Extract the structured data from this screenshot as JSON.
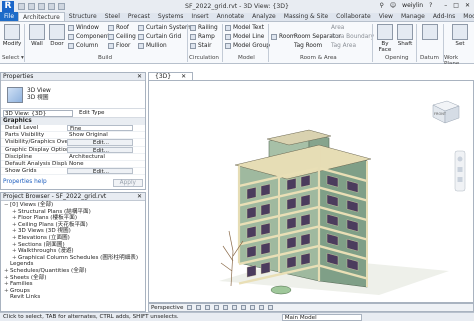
{
  "titlebar": {
    "app_logo": "R",
    "doc_title": "SF_2022_grid.rvt - 3D View: {3D}",
    "search_icon": "search-icon",
    "user": "weiylin",
    "help": "?"
  },
  "tabs": [
    "File",
    "Architecture",
    "Structure",
    "Steel",
    "Precast",
    "Systems",
    "Insert",
    "Annotate",
    "Analyze",
    "Massing & Site",
    "Collaborate",
    "View",
    "Manage",
    "Add-Ins",
    "Modify"
  ],
  "ribbon": {
    "modify_label": "Modify",
    "select_label": "Select ▾",
    "build": {
      "wall": "Wall",
      "door": "Door",
      "window": "Window",
      "component": "Component",
      "column": "Column",
      "roof": "Roof",
      "ceiling": "Ceiling",
      "floor": "Floor",
      "curtain_system": "Curtain System",
      "curtain_grid": "Curtain Grid",
      "mullion": "Mullion",
      "label": "Build"
    },
    "circulation": {
      "railing": "Railing",
      "ramp": "Ramp",
      "stair": "Stair",
      "label": "Circulation"
    },
    "model": {
      "model_text": "Model Text",
      "model_line": "Model Line",
      "model_group": "Model Group",
      "label": "Model"
    },
    "room_area": {
      "room": "Room",
      "room_separator": "Room Separator",
      "tag_room": "Tag Room",
      "area": "Area",
      "area_boundary": "Area Boundary",
      "tag_area": "Tag Area",
      "label": "Room & Area"
    },
    "opening": {
      "by_face": "By Face",
      "shaft": "Shaft",
      "label": "Opening"
    },
    "datum": {
      "label": "Datum"
    },
    "work_plane": {
      "set": "Set",
      "label": "Work Plane"
    }
  },
  "properties": {
    "title": "Properties",
    "type_line1": "3D View",
    "type_line2": "3D 視圖",
    "selector": "3D View: {3D}",
    "edit_type": "Edit Type",
    "group": "Graphics",
    "rows": [
      {
        "k": "Detail Level",
        "v": "Fine",
        "style": "box"
      },
      {
        "k": "Parts Visibility",
        "v": "Show Original",
        "style": "plain"
      },
      {
        "k": "Visibility/Graphics Overri...",
        "v": "Edit...",
        "style": "btn"
      },
      {
        "k": "Graphic Display Options",
        "v": "Edit...",
        "style": "btn"
      },
      {
        "k": "Discipline",
        "v": "Architectural",
        "style": "plain"
      },
      {
        "k": "Default Analysis Display S...",
        "v": "None",
        "style": "plain"
      },
      {
        "k": "Show Grids",
        "v": "Edit...",
        "style": "btn"
      }
    ],
    "help_link": "Properties help",
    "apply": "Apply"
  },
  "browser": {
    "title": "Project Browser - SF_2022_grid.rvt",
    "items": [
      {
        "indent": 0,
        "toggle": "−",
        "label": "[0] Views (全部)"
      },
      {
        "indent": 1,
        "toggle": "+",
        "label": "Structural Plans (結構平面)"
      },
      {
        "indent": 1,
        "toggle": "+",
        "label": "Floor Plans (樓板平面)"
      },
      {
        "indent": 1,
        "toggle": "+",
        "label": "Ceiling Plans (天花板平面)"
      },
      {
        "indent": 1,
        "toggle": "+",
        "label": "3D Views (3D 視圖)"
      },
      {
        "indent": 1,
        "toggle": "+",
        "label": "Elevations (立面圖)"
      },
      {
        "indent": 1,
        "toggle": "+",
        "label": "Sections (剖面圖)"
      },
      {
        "indent": 1,
        "toggle": "+",
        "label": "Walkthroughs (漫遊)"
      },
      {
        "indent": 1,
        "toggle": "+",
        "label": "Graphical Column Schedules (圖形柱明細表)"
      },
      {
        "indent": 0,
        "toggle": "",
        "label": "Legends"
      },
      {
        "indent": 0,
        "toggle": "+",
        "label": "Schedules/Quantities (全部)"
      },
      {
        "indent": 0,
        "toggle": "+",
        "label": "Sheets (全部)"
      },
      {
        "indent": 0,
        "toggle": "+",
        "label": "Families"
      },
      {
        "indent": 0,
        "toggle": "+",
        "label": "Groups"
      },
      {
        "indent": 0,
        "toggle": "",
        "label": "Revit Links"
      }
    ]
  },
  "view": {
    "tab": "{3D}",
    "view_cube_label": "FRONT",
    "projection": "Perspective"
  },
  "status": {
    "hint": "Click to select, TAB for alternates, CTRL adds, SHIFT unselects.",
    "model": "Main Model"
  },
  "colors": {
    "file_tab": "#1e6cc8",
    "facade": "#8fae8f",
    "slab": "#e9dfb6",
    "window": "#4b3c5d"
  }
}
